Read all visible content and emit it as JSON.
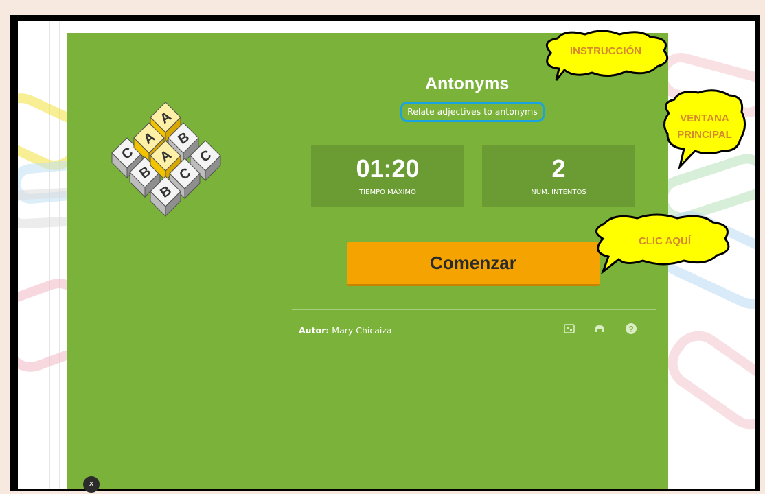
{
  "activity": {
    "title": "Antonyms",
    "instruction": "Relate adjectives to antonyms",
    "stats": [
      {
        "value": "01:20",
        "label": "TIEMPO MÁXIMO"
      },
      {
        "value": "2",
        "label": "NUM. INTENTOS"
      }
    ],
    "start_label": "Comenzar",
    "author_prefix": "Autor:",
    "author_name": "Mary Chicaiza"
  },
  "annotations": {
    "instruccion": "INSTRUCCIÓN",
    "ventana_line1": "VENTANA",
    "ventana_line2": "PRINCIPAL",
    "clic": "CLIC AQUÍ"
  },
  "logo_letters": [
    "A",
    "A",
    "A",
    "B",
    "C",
    "C",
    "B",
    "C",
    "B"
  ],
  "close_label": "x",
  "colors": {
    "panel": "#7bb23a",
    "stat_box": "#6b9c33",
    "start_button": "#f5a300",
    "bubble": "#ffff00",
    "annotation_text": "#d58a2e",
    "instruction_outline": "#1aa3e0"
  },
  "icons": [
    "fullscreen-icon",
    "print-icon",
    "help-icon"
  ]
}
